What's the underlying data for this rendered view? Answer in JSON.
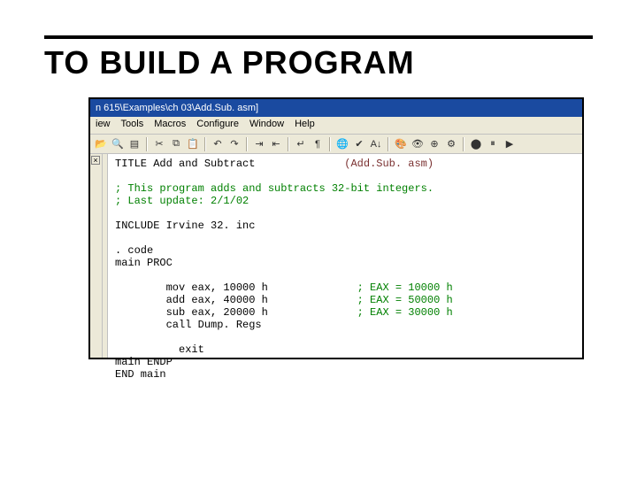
{
  "heading": "TO BUILD A PROGRAM",
  "titlebar": "n 615\\Examples\\ch 03\\Add.Sub. asm]",
  "menubar": [
    "iew",
    "Tools",
    "Macros",
    "Configure",
    "Window",
    "Help"
  ],
  "toolbar_icons": [
    {
      "name": "open-icon",
      "g": "📂"
    },
    {
      "name": "find-icon",
      "g": "🔍"
    },
    {
      "name": "list-icon",
      "g": "▤"
    },
    {
      "sep": true
    },
    {
      "name": "cut-icon",
      "g": "✂"
    },
    {
      "name": "copy-icon",
      "g": "⧉"
    },
    {
      "name": "paste-icon",
      "g": "📋"
    },
    {
      "sep": true
    },
    {
      "name": "undo-icon",
      "g": "↶"
    },
    {
      "name": "redo-icon",
      "g": "↷"
    },
    {
      "sep": true
    },
    {
      "name": "indent-icon",
      "g": "⇥"
    },
    {
      "name": "outdent-icon",
      "g": "⇤"
    },
    {
      "sep": true
    },
    {
      "name": "wrap-icon",
      "g": "↵"
    },
    {
      "name": "pilcrow-icon",
      "g": "¶"
    },
    {
      "sep": true
    },
    {
      "name": "globe-icon",
      "g": "🌐"
    },
    {
      "name": "spellcheck-icon",
      "g": "✔"
    },
    {
      "name": "sort-icon",
      "g": "A↓"
    },
    {
      "sep": true
    },
    {
      "name": "palette-icon",
      "g": "🎨"
    },
    {
      "name": "eye-icon",
      "g": "👁"
    },
    {
      "name": "zoomin-icon",
      "g": "⊕"
    },
    {
      "name": "plugin-icon",
      "g": "⚙"
    },
    {
      "sep": true
    },
    {
      "name": "record-icon",
      "g": "⬤"
    },
    {
      "name": "pause-icon",
      "g": "⏸"
    },
    {
      "name": "play-icon",
      "g": "▶"
    }
  ],
  "code": {
    "l1a": "TITLE Add and Subtract",
    "l1b": "(Add.Sub. asm)",
    "l3": "; This program adds and subtracts 32-bit integers.",
    "l4": "; Last update: 2/1/02",
    "l6": "INCLUDE Irvine 32. inc",
    "l8": ". code",
    "l9": "main PROC",
    "l11a": "        mov eax, 10000 h",
    "l11b": "; EAX = 10000 h",
    "l12a": "        add eax, 40000 h",
    "l12b": "; EAX = 50000 h",
    "l13a": "        sub eax, 20000 h",
    "l13b": "; EAX = 30000 h",
    "l14": "        call Dump. Regs",
    "l16": "          exit",
    "l17": "main ENDP",
    "l18": "END main"
  }
}
